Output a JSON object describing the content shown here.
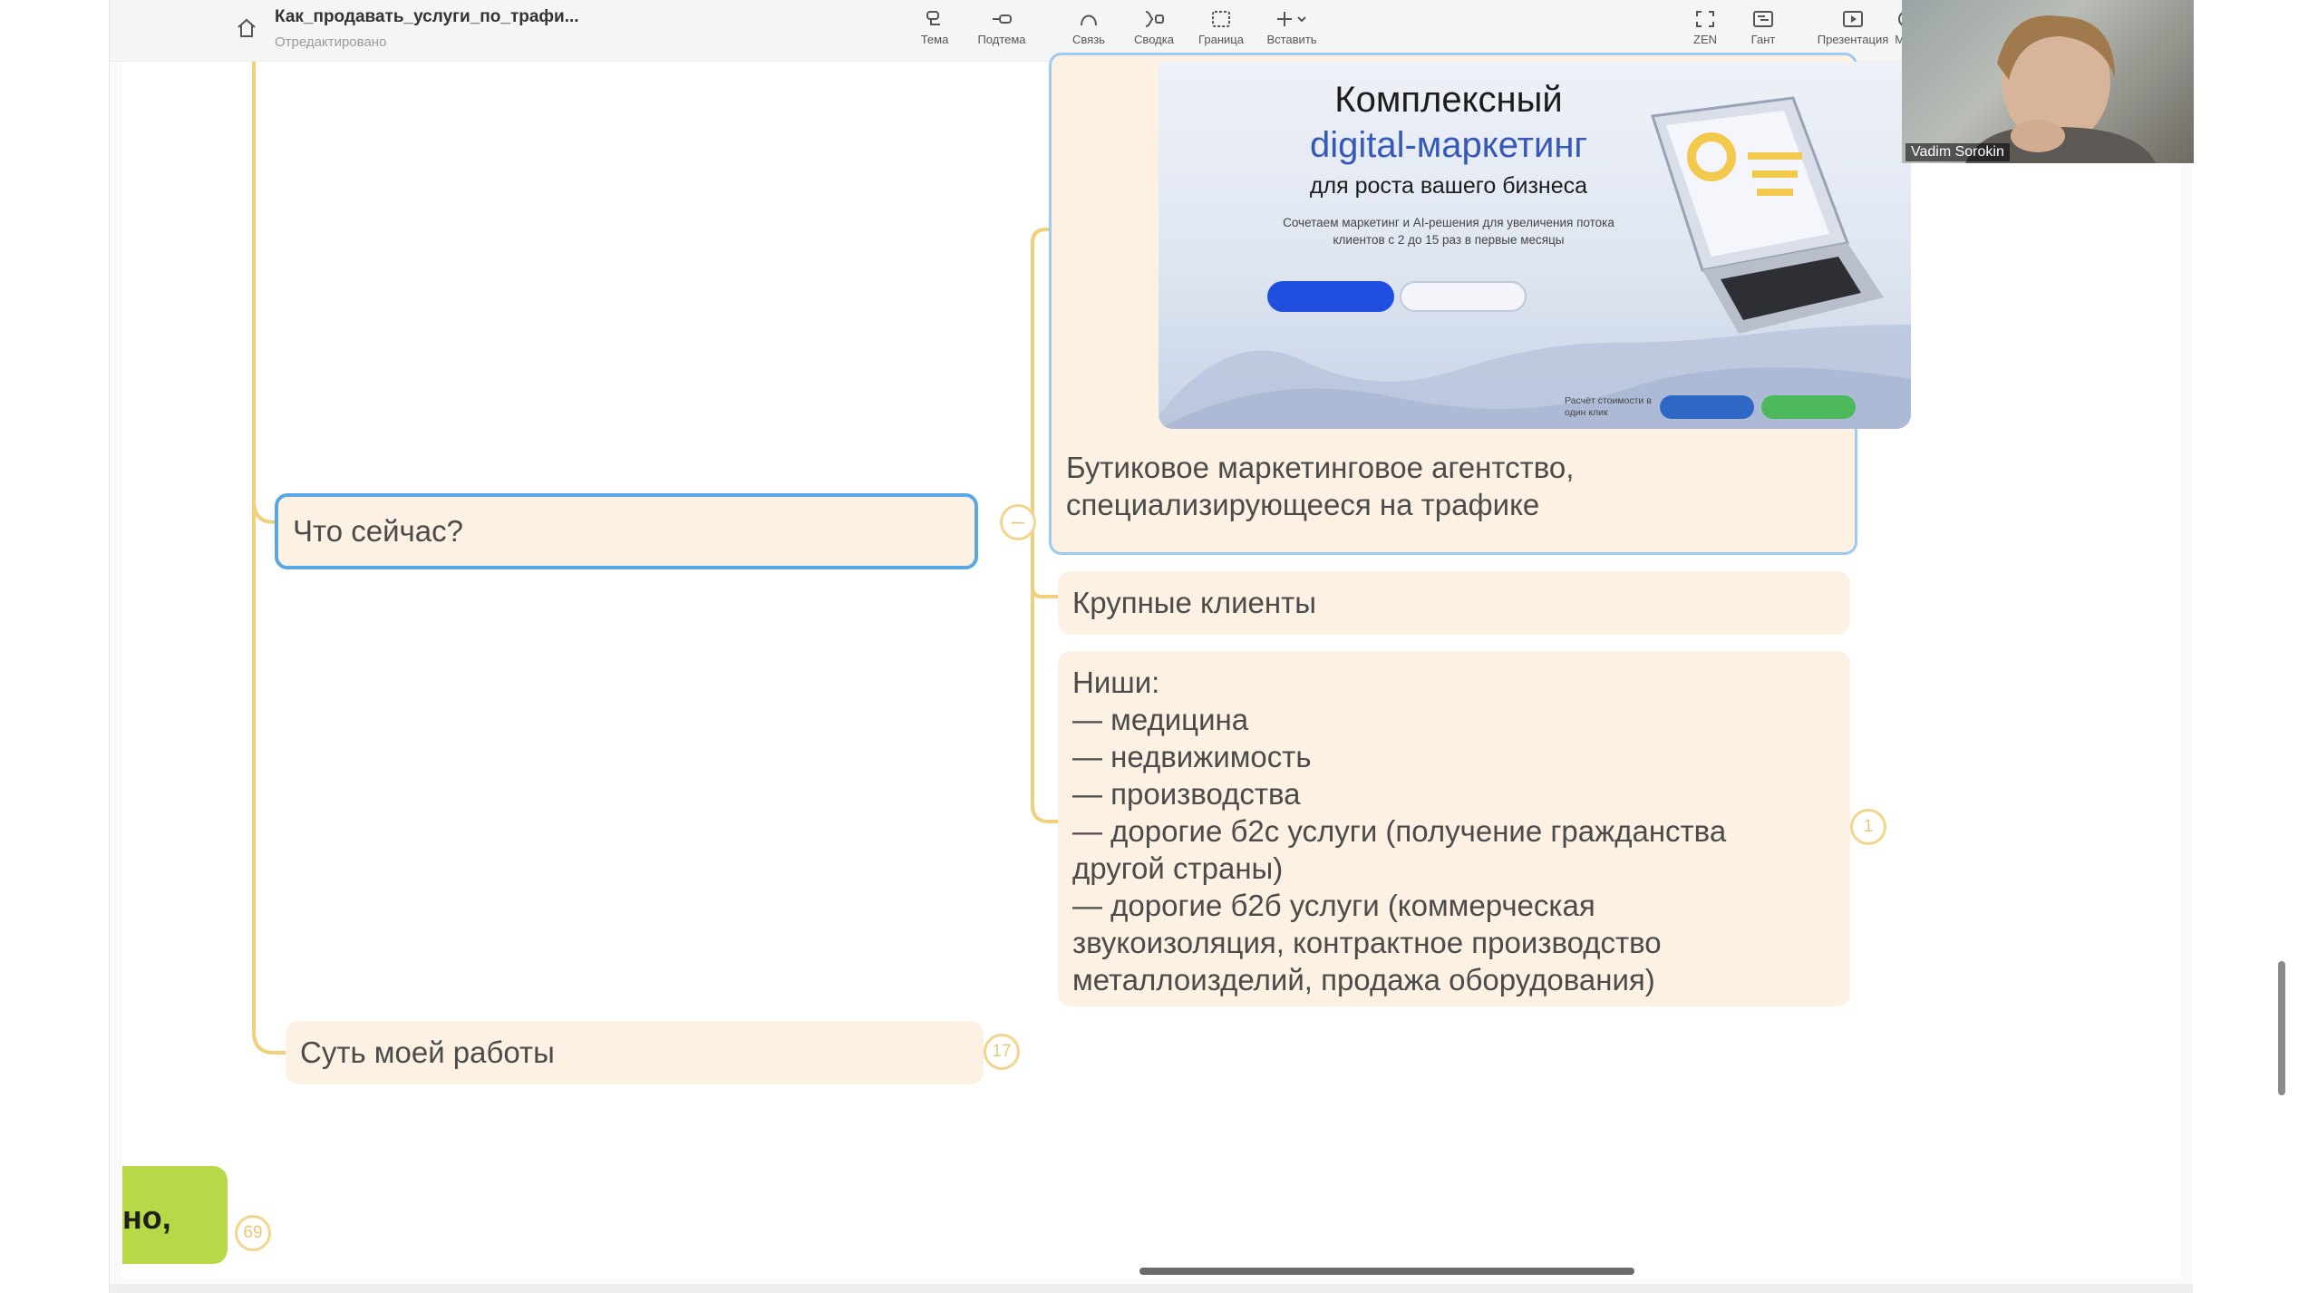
{
  "header": {
    "title": "Как_продавать_услуги_по_трафи...",
    "status": "Отредактировано"
  },
  "toolbar": {
    "left": [
      {
        "label": "Тема",
        "icon": "topic-icon"
      },
      {
        "label": "Подтема",
        "icon": "subtopic-icon"
      },
      {
        "label": "Связь",
        "icon": "relation-icon"
      },
      {
        "label": "Сводка",
        "icon": "summary-icon"
      },
      {
        "label": "Граница",
        "icon": "boundary-icon"
      },
      {
        "label": "Вставить",
        "icon": "insert-icon"
      }
    ],
    "right": [
      {
        "label": "ZEN",
        "icon": "zen-icon"
      },
      {
        "label": "Гант",
        "icon": "gantt-icon"
      },
      {
        "label": "Презентация",
        "icon": "presentation-icon"
      },
      {
        "label": "Мар",
        "icon": "map-icon"
      }
    ]
  },
  "mindmap": {
    "node_current": "Что сейчас?",
    "node_agency": "Бутиковое маркетинговое агентство,\nспециализирующееся на трафике",
    "node_clients": "Крупные клиенты",
    "node_niches": "Ниши:\n— медицина\n— недвижимость\n— производства\n— дорогие б2с услуги (получение гражданства\nдругой страны)\n— дорогие б2б услуги (коммерческая\nзвукоизоляция, контрактное производство\nметаллоизделий, продажа оборудования)",
    "node_work": "Суть моей работы",
    "badge_niches": "1",
    "badge_work": "17",
    "badge_bottom": "69",
    "bottom_node_text": "но,"
  },
  "landing": {
    "heading1": "Комплексный",
    "heading2": "digital-маркетинг",
    "heading3": "для роста вашего бизнеса",
    "paragraph": "Сочетаем маркетинг и AI-решения для увеличения потока клиентов с 2 до 15 раз в первые месяцы",
    "calc_text": "Расчёт стоимости в один клик"
  },
  "webcam": {
    "name": "Vadim Sorokin"
  },
  "colors": {
    "connector": "#f2cf7a",
    "node_bg": "#fdf1e3",
    "selection": "#5aa7e6",
    "accent_green": "#b7d948"
  }
}
